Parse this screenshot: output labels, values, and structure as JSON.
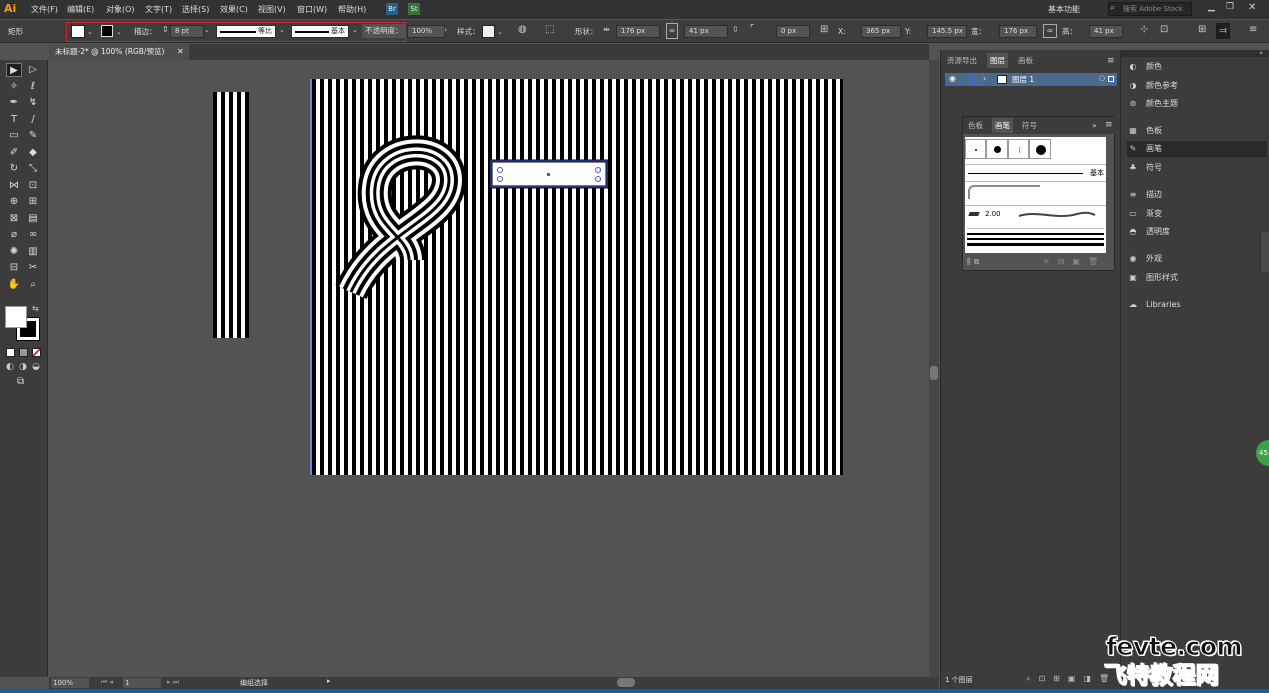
{
  "app": {
    "logo": "Ai"
  },
  "menus": [
    "文件(F)",
    "编辑(E)",
    "对象(O)",
    "文字(T)",
    "选择(S)",
    "效果(C)",
    "视图(V)",
    "窗口(W)",
    "帮助(H)"
  ],
  "menubar_right": {
    "bridge": "Br",
    "stock": "St",
    "workspace": "基本功能",
    "search_placeholder": "搜索 Adobe Stock"
  },
  "control": {
    "shape_label": "矩形",
    "stroke_label": "描边：",
    "stroke_weight": "8 pt",
    "profile": "等比",
    "brush": "基本",
    "opacity_label": "不透明度：",
    "opacity": "100%",
    "style_label": "样式：",
    "shape_word": "形状：",
    "shape_w": "176 px",
    "shape_h": "41 px",
    "corner": "0 px",
    "x_label": "X:",
    "x": "365 px",
    "y_label": "Y:",
    "y": "145.5 px",
    "w_label": "宽：",
    "w": "176 px",
    "h_label": "高：",
    "h": "41 px"
  },
  "document": {
    "tab_title": "未标题-2* @ 100% (RGB/预览)"
  },
  "status": {
    "zoom": "100%",
    "page": "1",
    "tool": "编组选择"
  },
  "layers_panel": {
    "tabs": [
      "资源导出",
      "图层",
      "画板"
    ],
    "active_tab": "图层",
    "layer_name": "图层 1",
    "footer": "1 个图层"
  },
  "brush_panel": {
    "tabs": [
      "色板",
      "画笔",
      "符号"
    ],
    "active_tab": "画笔",
    "basic_label": "基本",
    "size_label": "2.00"
  },
  "dock": [
    {
      "icon": "color-icon",
      "label": "颜色"
    },
    {
      "icon": "color-guide-icon",
      "label": "颜色参考"
    },
    {
      "icon": "color-theme-icon",
      "label": "颜色主题"
    },
    {
      "icon": "swatches-icon",
      "label": "色板"
    },
    {
      "icon": "brush-icon",
      "label": "画笔"
    },
    {
      "icon": "symbol-icon",
      "label": "符号"
    },
    {
      "icon": "stroke-icon",
      "label": "描边"
    },
    {
      "icon": "gradient-icon",
      "label": "渐变"
    },
    {
      "icon": "transparency-icon",
      "label": "透明度"
    },
    {
      "icon": "appearance-icon",
      "label": "外观"
    },
    {
      "icon": "graphic-styles-icon",
      "label": "图形样式"
    },
    {
      "icon": "libraries-icon",
      "label": "Libraries"
    }
  ],
  "watermark": {
    "line1": "fevte.com",
    "line2": "飞特教程网"
  },
  "colors": {
    "accent_red": "#d2232a",
    "selection_blue": "#3b5bdb",
    "brand_orange": "#ff9a00"
  }
}
